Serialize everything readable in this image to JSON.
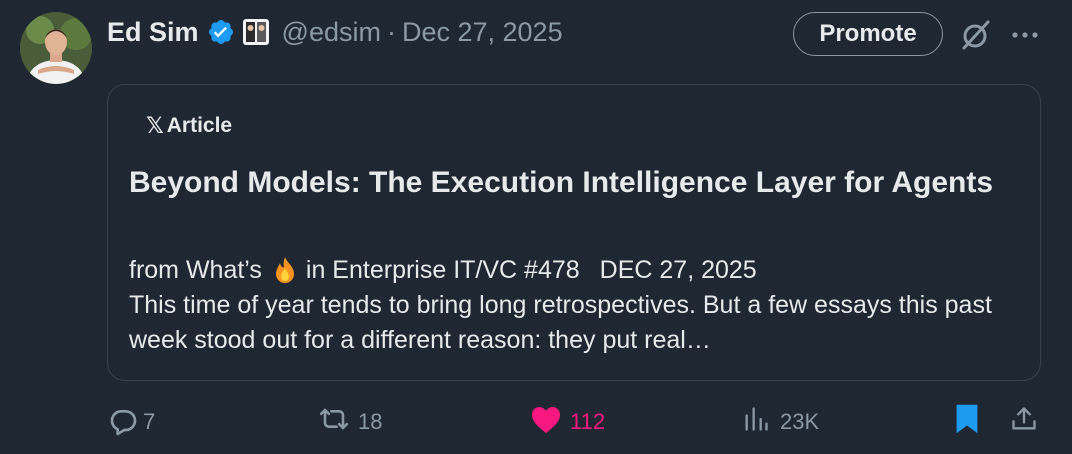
{
  "post": {
    "author_name": "Ed Sim",
    "handle": "@edsim",
    "separator": "·",
    "date": "Dec 27, 2025",
    "promote_label": "Promote"
  },
  "card": {
    "tag": "Article",
    "title": "Beyond Models: The Execution Intelligence Layer for Agents",
    "meta_from": "from What’s",
    "meta_after": "in Enterprise IT/VC #478",
    "meta_date": "DEC 27, 2025",
    "excerpt": "This time of year tends to bring long retrospectives. But a few essays this past week stood out for a different reason: they put real…"
  },
  "actions": {
    "replies": "7",
    "reposts": "18",
    "likes": "112",
    "views": "23K"
  },
  "icons": [
    "verified-icon",
    "affiliate-badge-icon",
    "grok-icon",
    "more-icon",
    "fire-icon",
    "reply-icon",
    "repost-icon",
    "like-icon",
    "views-icon",
    "bookmark-icon",
    "share-icon"
  ],
  "colors": {
    "background": "#1e2732",
    "text": "#e7e9ea",
    "muted": "#8b98a5",
    "verified": "#1d9bf0",
    "like": "#f91880",
    "bookmark": "#1d9bf0",
    "border": "#38444d"
  }
}
